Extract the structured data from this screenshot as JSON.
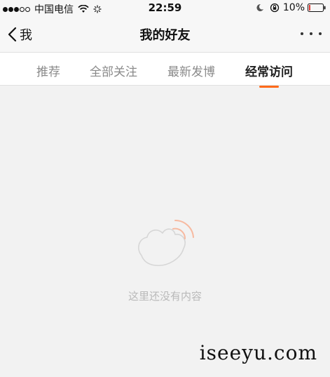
{
  "status_bar": {
    "carrier": "中国电信",
    "time": "22:59",
    "battery_percent": "10%",
    "battery_level": 0.1,
    "signal_full_dots": 3,
    "signal_total_dots": 5,
    "battery_color": "#e0312b"
  },
  "nav": {
    "back_label": "我",
    "title": "我的好友"
  },
  "tabs": [
    {
      "label": "推荐",
      "active": false
    },
    {
      "label": "全部关注",
      "active": false
    },
    {
      "label": "最新发博",
      "active": false
    },
    {
      "label": "经常访问",
      "active": true
    }
  ],
  "accent_color": "#ff6a1a",
  "empty_state": {
    "text": "这里还没有内容",
    "icon": "empty-hand-icon"
  },
  "watermark": "iseeyu.com"
}
